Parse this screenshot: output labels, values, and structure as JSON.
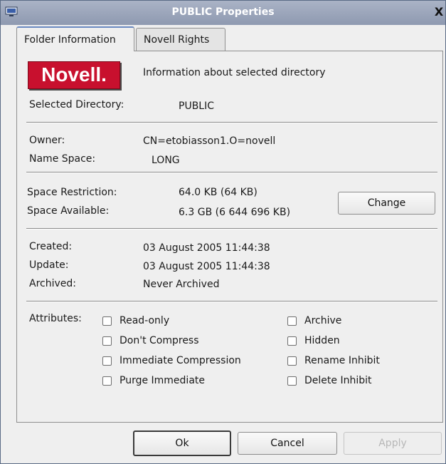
{
  "window": {
    "title": "PUBLIC Properties",
    "close": "X"
  },
  "tabs": [
    "Folder Information",
    "Novell Rights"
  ],
  "logo_text": "Novell.",
  "header_info": "Information about selected directory",
  "selected_directory": {
    "label": "Selected Directory:",
    "value": "PUBLIC"
  },
  "owner": {
    "label": "Owner:",
    "value": "CN=etobiasson1.O=novell"
  },
  "name_space": {
    "label": "Name Space:",
    "value": "LONG"
  },
  "space_restriction": {
    "label": "Space Restriction:",
    "value": "64.0 KB (64 KB)"
  },
  "space_available": {
    "label": "Space Available:",
    "value": "6.3 GB (6 644 696 KB)"
  },
  "change_button": "Change",
  "created": {
    "label": "Created:",
    "value": "03 August 2005 11:44:38"
  },
  "update": {
    "label": "Update:",
    "value": "03 August 2005 11:44:38"
  },
  "archived": {
    "label": "Archived:",
    "value": "Never Archived"
  },
  "attributes_label": "Attributes:",
  "attributes_left": [
    {
      "label": "Read-only",
      "checked": false
    },
    {
      "label": "Don't Compress",
      "checked": false
    },
    {
      "label": "Immediate Compression",
      "checked": false
    },
    {
      "label": "Purge Immediate",
      "checked": false
    }
  ],
  "attributes_right": [
    {
      "label": "Archive",
      "checked": false
    },
    {
      "label": "Hidden",
      "checked": false
    },
    {
      "label": "Rename Inhibit",
      "checked": false
    },
    {
      "label": "Delete Inhibit",
      "checked": false
    }
  ],
  "buttons": {
    "ok": "Ok",
    "cancel": "Cancel",
    "apply": "Apply"
  }
}
